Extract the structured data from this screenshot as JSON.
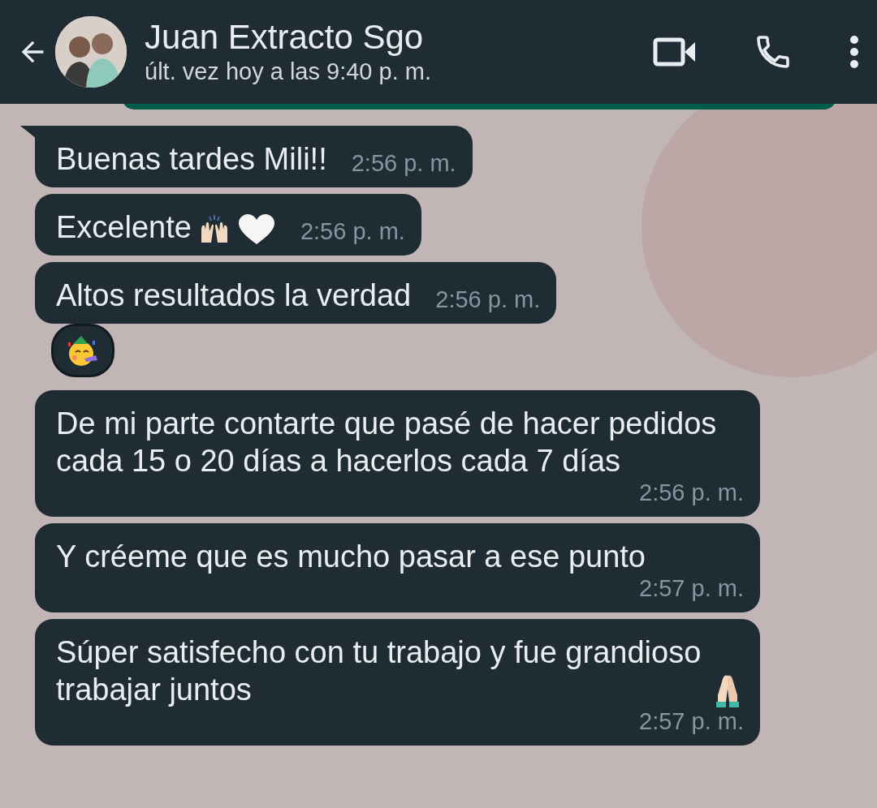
{
  "header": {
    "name": "Juan Extracto Sgo",
    "status": "últ. vez hoy a las 9:40 p. m."
  },
  "messages": [
    {
      "text": "Buenas tardes Mili!!",
      "time": "2:56 p. m.",
      "tail": true
    },
    {
      "text": "Excelente",
      "time": "2:56 p. m.",
      "tail": false,
      "icons": [
        {
          "kind": "raised-hands"
        },
        {
          "kind": "heart"
        }
      ]
    },
    {
      "text": "Altos resultados la verdad",
      "time": "2:56 p. m.",
      "tail": false,
      "reaction": {
        "kind": "party-face"
      }
    },
    {
      "text": "De mi parte contarte que pasé de hacer pedidos cada 15 o 20 días a hacerlos cada 7 días",
      "time": "2:56 p. m.",
      "tail": false
    },
    {
      "text": "Y créeme que es mucho pasar a ese punto",
      "time": "2:57 p. m.",
      "tail": false
    },
    {
      "text": "Súper satisfecho con tu trabajo y fue grandioso trabajar juntos",
      "time": "2:57 p. m.",
      "tail": false,
      "icons": [
        {
          "kind": "praying-hands"
        }
      ]
    }
  ]
}
